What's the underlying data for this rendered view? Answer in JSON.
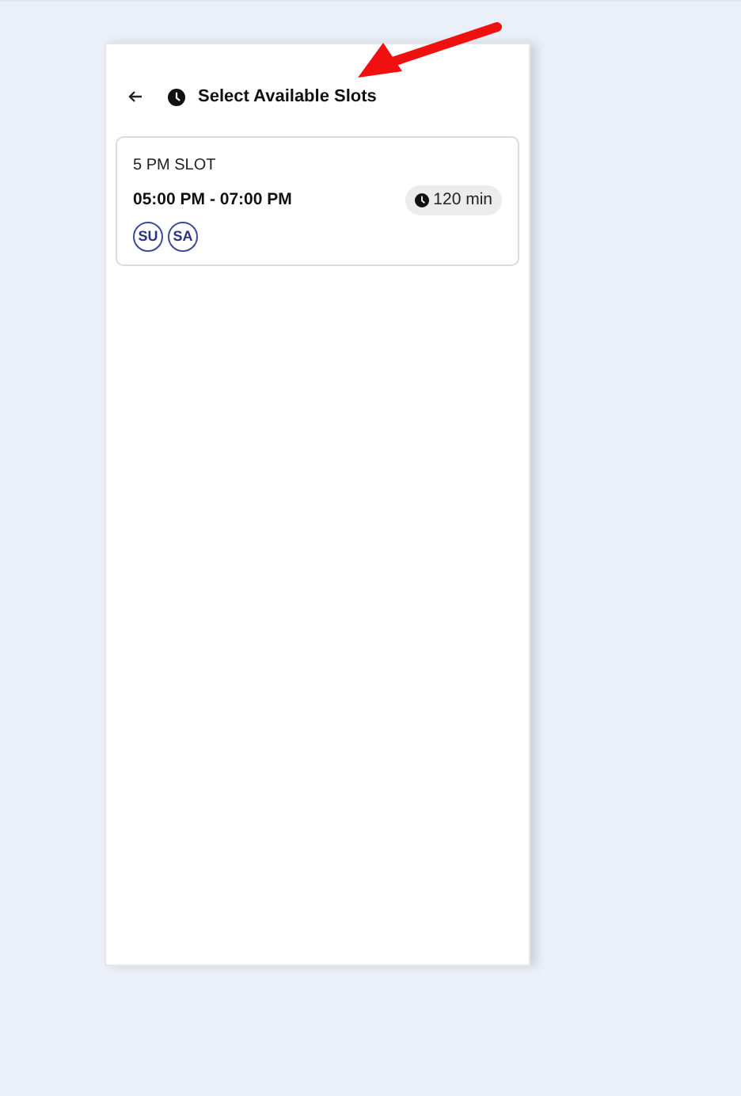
{
  "header": {
    "title": "Select Available Slots"
  },
  "slots": [
    {
      "name": "5 PM SLOT",
      "time": "05:00 PM - 07:00 PM",
      "duration": "120 min",
      "days": [
        "SU",
        "SA"
      ]
    }
  ]
}
